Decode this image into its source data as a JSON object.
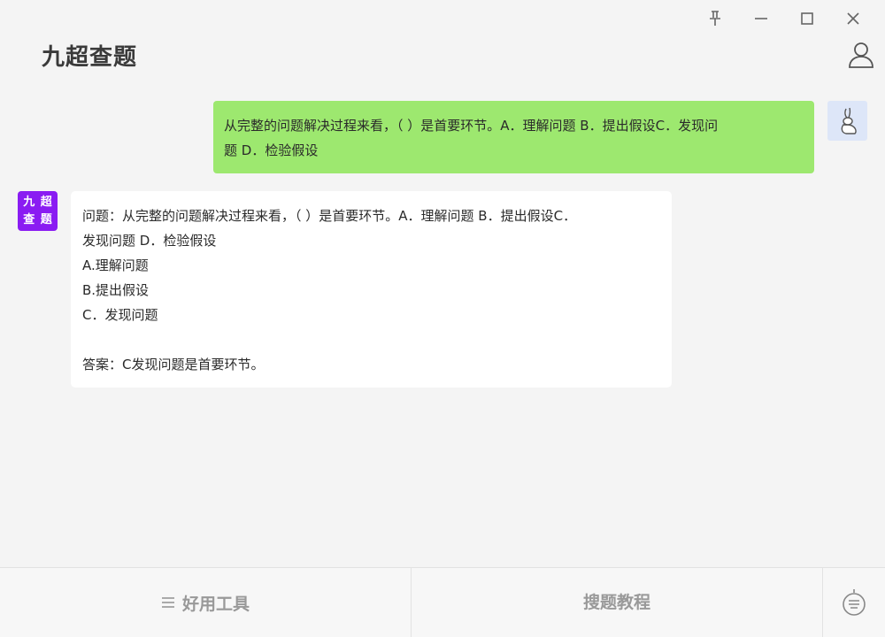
{
  "app": {
    "title": "九超查题"
  },
  "window_controls": {
    "pin_icon": "pin-icon",
    "minimize_icon": "minimize-icon",
    "maximize_icon": "maximize-icon",
    "close_icon": "close-icon"
  },
  "chat": {
    "user_message": {
      "lines": [
        "从完整的问题解决过程来看，（ ）是首要环节。A．理解问题 B．提出假设C．发现问",
        "题 D．检验假设"
      ]
    },
    "bot_avatar": {
      "chars": [
        "九",
        "超",
        "查",
        "题"
      ]
    },
    "bot_message": {
      "lines": [
        "问题：从完整的问题解决过程来看，（ ）是首要环节。A．理解问题 B．提出假设C．",
        "发现问题 D．检验假设",
        "A.理解问题",
        "B.提出假设",
        "C．发现问题",
        "",
        "答案：C发现问题是首要环节。"
      ]
    }
  },
  "bottom_bar": {
    "tools_label": "好用工具",
    "tutorial_label": "搜题教程",
    "keyboard_icon": "keyboard-icon"
  },
  "colors": {
    "user_bubble": "#9de86f",
    "bot_bubble": "#ffffff",
    "bot_avatar": "#8a1cf2",
    "background": "#f4f4f4"
  }
}
